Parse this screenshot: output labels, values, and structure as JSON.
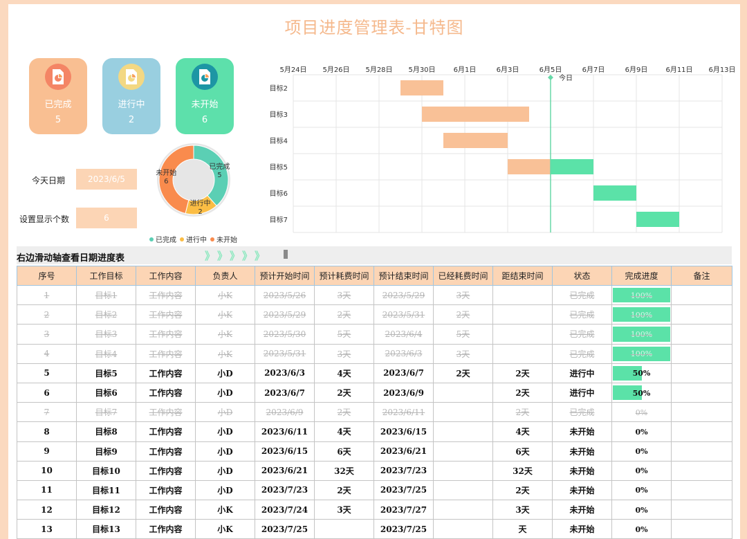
{
  "title": "项目进度管理表-甘特图",
  "colors": {
    "done": "#5bcfb4",
    "inprogress": "#fbbd44",
    "notstarted": "#f98b4d",
    "gantt_planned": "#f9c197",
    "gantt_green": "#5be2a8",
    "today_line": "#68d8a8"
  },
  "cards": [
    {
      "label": "已完成",
      "count": "5",
      "icon": "pie-chart-document-icon",
      "bg": "#f9bf92",
      "circle": "#f48565"
    },
    {
      "label": "进行中",
      "count": "2",
      "icon": "pie-chart-document-icon",
      "bg": "#99cfe0",
      "circle": "#f3d883"
    },
    {
      "label": "未开始",
      "count": "6",
      "icon": "pie-chart-document-icon",
      "bg": "#5de0ab",
      "circle": "#1d96a4"
    }
  ],
  "fields": {
    "today_label": "今天日期",
    "today_value": "2023/6/5",
    "count_label": "设置显示个数",
    "count_value": "6"
  },
  "donut": {
    "slices": [
      {
        "label": "已完成",
        "value": 5,
        "color": "#5bcfb4"
      },
      {
        "label": "进行中",
        "value": 2,
        "color": "#fbbd44"
      },
      {
        "label": "未开始",
        "value": 6,
        "color": "#f98b4d"
      }
    ],
    "legend": [
      "已完成",
      "进行中",
      "未开始"
    ]
  },
  "gantt": {
    "ticks": [
      "5月24日",
      "5月26日",
      "5月28日",
      "5月30日",
      "6月1日",
      "6月3日",
      "6月5日",
      "6月7日",
      "6月9日",
      "6月11日",
      "6月13日"
    ],
    "today_label": "今日",
    "today": "2023-06-05",
    "rows": [
      {
        "name": "目标2",
        "bars": [
          {
            "start": "2023-05-29",
            "end": "2023-05-31",
            "kind": "planned"
          }
        ]
      },
      {
        "name": "目标3",
        "bars": [
          {
            "start": "2023-05-30",
            "end": "2023-06-04",
            "kind": "planned"
          }
        ]
      },
      {
        "name": "目标4",
        "bars": [
          {
            "start": "2023-05-31",
            "end": "2023-06-03",
            "kind": "planned"
          }
        ]
      },
      {
        "name": "目标5",
        "bars": [
          {
            "start": "2023-06-03",
            "end": "2023-06-05",
            "kind": "planned"
          },
          {
            "start": "2023-06-05",
            "end": "2023-06-07",
            "kind": "active"
          }
        ]
      },
      {
        "name": "目标6",
        "bars": [
          {
            "start": "2023-06-07",
            "end": "2023-06-09",
            "kind": "active"
          }
        ]
      },
      {
        "name": "目标7",
        "bars": [
          {
            "start": "2023-06-09",
            "end": "2023-06-11",
            "kind": "active"
          }
        ]
      }
    ]
  },
  "scroll": {
    "title": "右边滑动轴查看日期进度表",
    "chevron": "》"
  },
  "table": {
    "headers": [
      "序号",
      "工作目标",
      "工作内容",
      "负责人",
      "预计开始时间",
      "预计耗费时间",
      "预计结束时间",
      "已经耗费时间",
      "距结束时间",
      "状态",
      "完成进度",
      "备注"
    ],
    "rows": [
      {
        "cells": [
          "1",
          "目标1",
          "工作内容",
          "小K",
          "2023/5/26",
          "3天",
          "2023/5/29",
          "3天",
          "",
          "已完成"
        ],
        "progress": 1.0,
        "progress_text": "100%",
        "note": "",
        "done": true
      },
      {
        "cells": [
          "2",
          "目标2",
          "工作内容",
          "小K",
          "2023/5/29",
          "2天",
          "2023/5/31",
          "2天",
          "",
          "已完成"
        ],
        "progress": 1.0,
        "progress_text": "100%",
        "note": "",
        "done": true
      },
      {
        "cells": [
          "3",
          "目标3",
          "工作内容",
          "小K",
          "2023/5/30",
          "5天",
          "2023/6/4",
          "5天",
          "",
          "已完成"
        ],
        "progress": 1.0,
        "progress_text": "100%",
        "note": "",
        "done": true
      },
      {
        "cells": [
          "4",
          "目标4",
          "工作内容",
          "小K",
          "2023/5/31",
          "3天",
          "2023/6/3",
          "3天",
          "",
          "已完成"
        ],
        "progress": 1.0,
        "progress_text": "100%",
        "note": "",
        "done": true
      },
      {
        "cells": [
          "5",
          "目标5",
          "工作内容",
          "小D",
          "2023/6/3",
          "4天",
          "2023/6/7",
          "2天",
          "2天",
          "进行中"
        ],
        "progress": 0.5,
        "progress_text": "50%",
        "note": "",
        "done": false
      },
      {
        "cells": [
          "6",
          "目标6",
          "工作内容",
          "小D",
          "2023/6/7",
          "2天",
          "2023/6/9",
          "",
          "2天",
          "进行中"
        ],
        "progress": 0.5,
        "progress_text": "50%",
        "note": "",
        "done": false
      },
      {
        "cells": [
          "7",
          "目标7",
          "工作内容",
          "小D",
          "2023/6/9",
          "2天",
          "2023/6/11",
          "",
          "2天",
          "已完成"
        ],
        "progress": 0,
        "progress_text": "0%",
        "note": "",
        "done": true
      },
      {
        "cells": [
          "8",
          "目标8",
          "工作内容",
          "小D",
          "2023/6/11",
          "4天",
          "2023/6/15",
          "",
          "4天",
          "未开始"
        ],
        "progress": 0,
        "progress_text": "0%",
        "note": "",
        "done": false
      },
      {
        "cells": [
          "9",
          "目标9",
          "工作内容",
          "小D",
          "2023/6/15",
          "6天",
          "2023/6/21",
          "",
          "6天",
          "未开始"
        ],
        "progress": 0,
        "progress_text": "0%",
        "note": "",
        "done": false
      },
      {
        "cells": [
          "10",
          "目标10",
          "工作内容",
          "小D",
          "2023/6/21",
          "32天",
          "2023/7/23",
          "",
          "32天",
          "未开始"
        ],
        "progress": 0,
        "progress_text": "0%",
        "note": "",
        "done": false
      },
      {
        "cells": [
          "11",
          "目标11",
          "工作内容",
          "小D",
          "2023/7/23",
          "2天",
          "2023/7/25",
          "",
          "2天",
          "未开始"
        ],
        "progress": 0,
        "progress_text": "0%",
        "note": "",
        "done": false
      },
      {
        "cells": [
          "12",
          "目标12",
          "工作内容",
          "小K",
          "2023/7/24",
          "3天",
          "2023/7/27",
          "",
          "3天",
          "未开始"
        ],
        "progress": 0,
        "progress_text": "0%",
        "note": "",
        "done": false
      },
      {
        "cells": [
          "13",
          "目标13",
          "工作内容",
          "小K",
          "2023/7/25",
          "",
          "2023/7/25",
          "",
          "天",
          "未开始"
        ],
        "progress": 0,
        "progress_text": "0%",
        "note": "",
        "done": false
      }
    ]
  }
}
